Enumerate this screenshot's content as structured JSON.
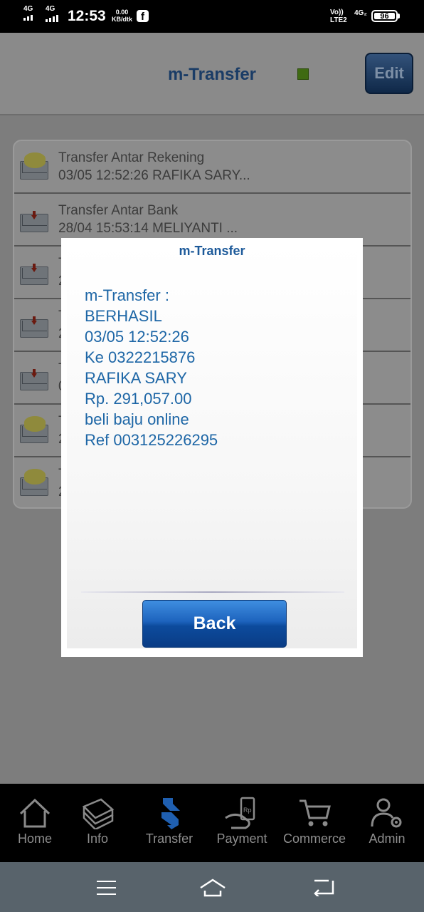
{
  "status_bar": {
    "sim1_network": "4G",
    "sim2_network": "4G",
    "time": "12:53",
    "speed_value": "0.00",
    "speed_unit": "KB/dtk",
    "volte_label": "Vo))",
    "lte_label": "LTE2",
    "right_network": "4G₂",
    "battery": "96",
    "fb_icon": "facebook-icon"
  },
  "header": {
    "title": "m-Transfer",
    "edit_label": "Edit",
    "status_led_color": "#4fae1e"
  },
  "messages": [
    {
      "title": "Transfer Antar Rekening",
      "sub": "03/05 12:52:26 RAFIKA SARY...",
      "icon": "envelope-open-icon"
    },
    {
      "title": "Transfer Antar Bank",
      "sub": "28/04 15:53:14 MELIYANTI  ...",
      "icon": "envelope-arrow-icon"
    },
    {
      "title": "T",
      "sub": "2",
      "icon": "envelope-arrow-icon"
    },
    {
      "title": "T",
      "sub": "2",
      "icon": "envelope-arrow-icon"
    },
    {
      "title": "T",
      "sub": "0",
      "icon": "envelope-arrow-icon"
    },
    {
      "title": "T",
      "sub": "2",
      "icon": "envelope-open-icon"
    },
    {
      "title": "T",
      "sub": "2",
      "icon": "envelope-open-icon"
    }
  ],
  "dialog": {
    "title": "m-Transfer",
    "lines": [
      "m-Transfer :",
      "BERHASIL",
      "03/05 12:52:26",
      "Ke 0322215876",
      "RAFIKA SARY",
      "Rp. 291,057.00",
      "beli baju online",
      "Ref 003125226295"
    ],
    "back_label": "Back"
  },
  "bottom_nav": [
    {
      "label": "Home",
      "icon": "home-icon"
    },
    {
      "label": "Info",
      "icon": "info-book-icon"
    },
    {
      "label": "Transfer",
      "icon": "transfer-icon"
    },
    {
      "label": "Payment",
      "icon": "payment-icon"
    },
    {
      "label": "Commerce",
      "icon": "cart-icon"
    },
    {
      "label": "Admin",
      "icon": "admin-user-icon"
    }
  ]
}
